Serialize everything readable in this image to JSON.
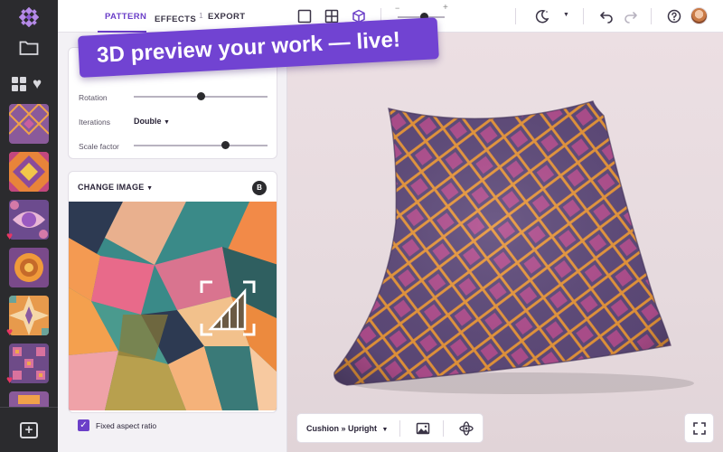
{
  "tabs": [
    {
      "label": "PATTERN",
      "active": true
    },
    {
      "label": "EFFECTS",
      "count": "1",
      "active": false
    },
    {
      "label": "EXPORT",
      "active": false
    }
  ],
  "params": {
    "rotation_label": "Rotation",
    "rotation_value": 0.5,
    "iterations_label": "Iterations",
    "iterations_value": "Double",
    "scale_label": "Scale factor",
    "scale_value": 0.68
  },
  "image_card": {
    "change_label": "CHANGE IMAGE",
    "badge": "B"
  },
  "fixed_aspect": {
    "label": "Fixed aspect ratio",
    "checked": true
  },
  "banner": {
    "text": "3D preview your work — live!"
  },
  "viewport": {
    "model_select": "Cushion » Upright"
  },
  "toolbar": {
    "zoom_minus": "−",
    "zoom_plus": "+",
    "zoom_level": 0.55
  },
  "rail": {
    "favorites_count": 3
  },
  "colors": {
    "accent": "#6b3fc8",
    "banner": "#7143d2",
    "rail": "#2b2b2e",
    "favorite": "#e83663",
    "cushion_base": "#5e4a7a",
    "cushion_lines": "#e8963a",
    "cushion_fill": "#b04e8e"
  },
  "icons": [
    "logo-icon",
    "folder-icon",
    "grid-icon",
    "heart-icon",
    "add-icon",
    "single-view-icon",
    "quad-view-icon",
    "cube-icon",
    "theme-icon",
    "undo-icon",
    "redo-icon",
    "help-icon",
    "image-icon",
    "orbit-icon",
    "fullscreen-icon",
    "crop-icon"
  ]
}
